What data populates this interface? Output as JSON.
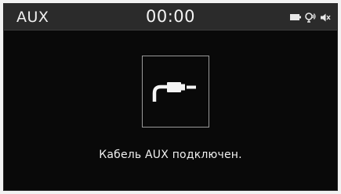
{
  "status_bar": {
    "source": "AUX",
    "time": "00:00",
    "icons": [
      "battery-icon",
      "voice-recognition-icon",
      "mute-icon"
    ]
  },
  "main": {
    "icon": "aux-cable-plug-icon",
    "message": "Кабель AUX подключен."
  },
  "colors": {
    "background": "#090909",
    "status_bar": "#2b2b2b",
    "text": "#f0f0f0",
    "frame_border": "#9a9a9a"
  }
}
